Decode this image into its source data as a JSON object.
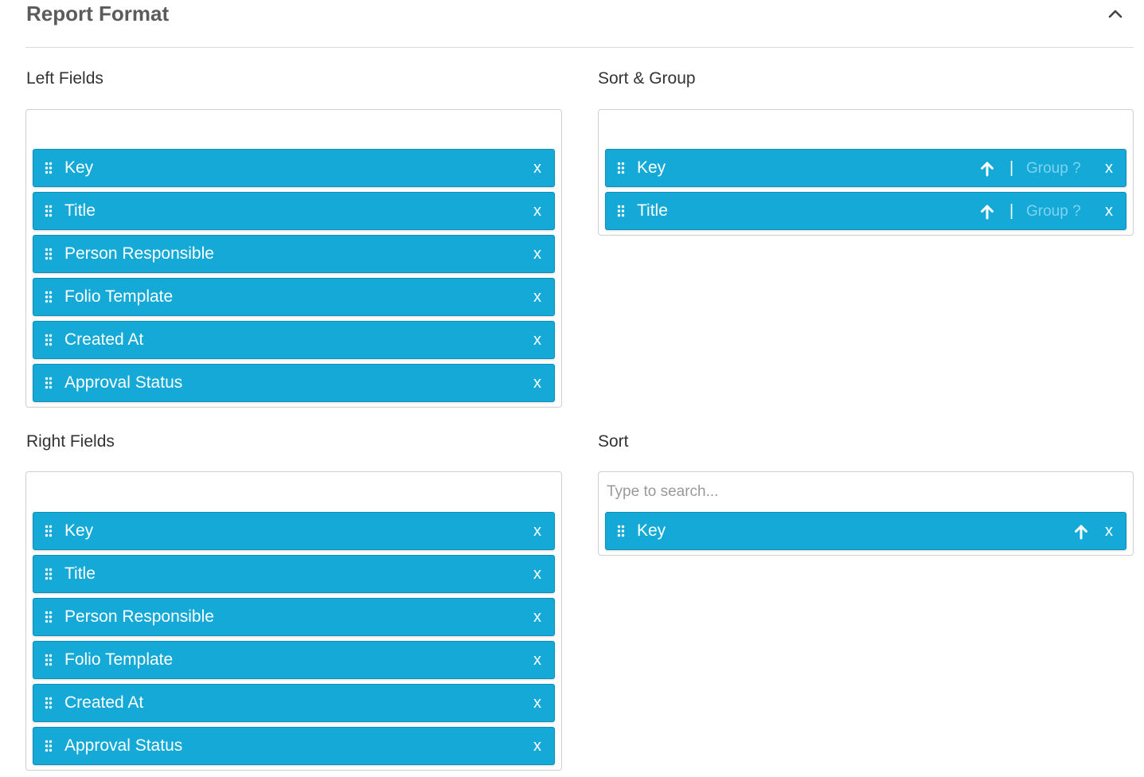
{
  "header": {
    "title": "Report Format",
    "collapse_icon": "chevron-up-icon"
  },
  "left_fields": {
    "label": "Left Fields",
    "items": [
      "Key",
      "Title",
      "Person Responsible",
      "Folio Template",
      "Created At",
      "Approval Status"
    ]
  },
  "right_fields": {
    "label": "Right Fields",
    "items": [
      "Key",
      "Title",
      "Person Responsible",
      "Folio Template",
      "Created At",
      "Approval Status"
    ]
  },
  "sort_group": {
    "label": "Sort & Group",
    "items": [
      {
        "label": "Key",
        "direction_icon": "arrow-up-icon",
        "separator": "|",
        "group_label": "Group ?"
      },
      {
        "label": "Title",
        "direction_icon": "arrow-up-icon",
        "separator": "|",
        "group_label": "Group ?"
      }
    ]
  },
  "sort": {
    "label": "Sort",
    "search_placeholder": "Type to search...",
    "items": [
      {
        "label": "Key",
        "direction_icon": "arrow-up-icon"
      }
    ]
  },
  "remove_label": "x",
  "colors": {
    "chip": "#14a9d7",
    "group_text": "#7fd3ee"
  }
}
